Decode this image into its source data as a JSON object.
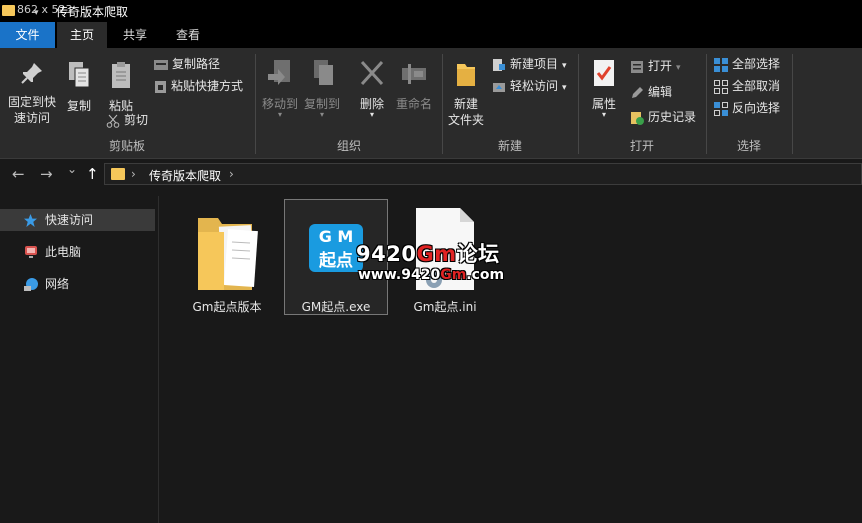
{
  "titlebar": {
    "dims": "862 x 523",
    "title": "传奇版本爬取",
    "qa_sep": "|",
    "qa_arrow": "▾"
  },
  "tabs": {
    "file": "文件",
    "home": "主页",
    "share": "共享",
    "view": "查看"
  },
  "ribbon": {
    "clipboard": {
      "pin": "固定到快速访问",
      "pin_l1": "固定到快",
      "pin_l2": "速访问",
      "copy": "复制",
      "paste": "粘贴",
      "copy_path": "复制路径",
      "paste_shortcut": "粘贴快捷方式",
      "cut": "剪切",
      "label": "剪贴板"
    },
    "organize": {
      "move_to": "移动到",
      "copy_to": "复制到",
      "delete": "删除",
      "rename": "重命名",
      "label": "组织"
    },
    "new": {
      "new_folder_l1": "新建",
      "new_folder_l2": "文件夹",
      "new_item": "新建项目",
      "easy_access": "轻松访问",
      "label": "新建"
    },
    "open": {
      "properties": "属性",
      "open": "打开",
      "edit": "编辑",
      "history": "历史记录",
      "label": "打开"
    },
    "select": {
      "select_all": "全部选择",
      "select_none": "全部取消",
      "invert": "反向选择",
      "label": "选择"
    }
  },
  "nav": {
    "path": "传奇版本爬取",
    "back": "←",
    "forward": "→",
    "recent": "⌄",
    "up": "↑",
    "chevron": "›"
  },
  "sidebar": {
    "items": [
      {
        "label": "快速访问",
        "icon": "star-icon"
      },
      {
        "label": "此电脑",
        "icon": "computer-icon"
      },
      {
        "label": "网络",
        "icon": "network-icon"
      }
    ]
  },
  "files": [
    {
      "name": "Gm起点版本",
      "type": "folder"
    },
    {
      "name": "GM起点.exe",
      "type": "exe",
      "icon_text_top": "G M",
      "icon_text_bottom": "起点"
    },
    {
      "name": "Gm起点.ini",
      "type": "ini"
    }
  ],
  "watermark": {
    "line1_a": "9420",
    "line1_b": "Gm",
    "line1_c": "论坛",
    "line2_a": "www.9420",
    "line2_b": "Gm",
    "line2_c": ".com"
  },
  "colors": {
    "accent": "#1a73c8",
    "folder": "#f6c75a",
    "background": "#191919",
    "ribbon": "#2b2b2b"
  }
}
